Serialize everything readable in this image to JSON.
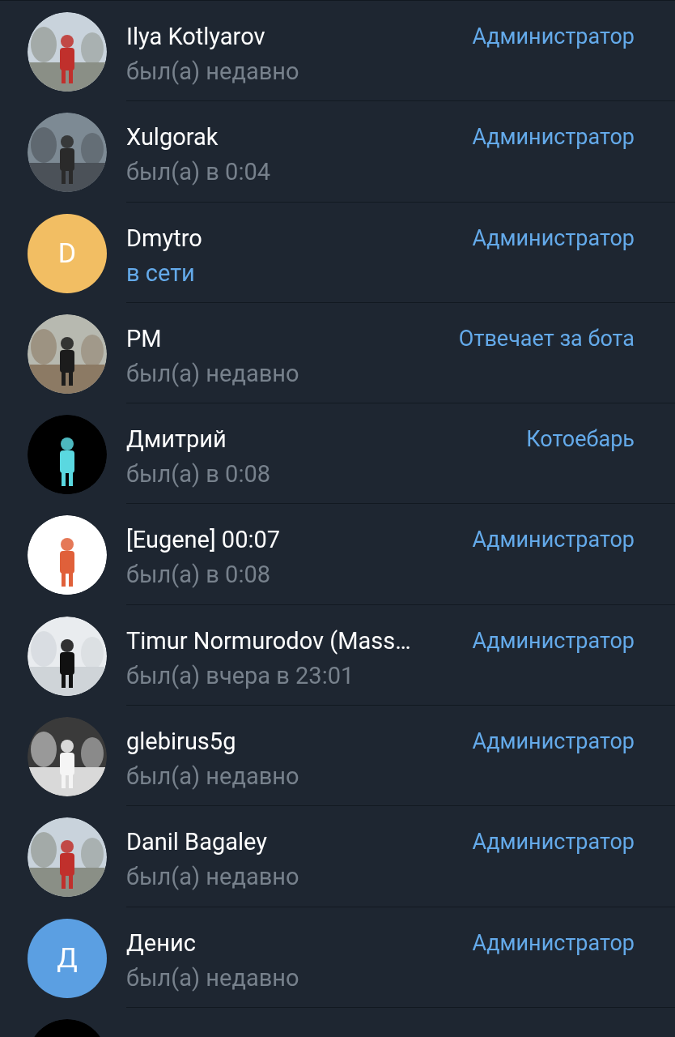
{
  "members": [
    {
      "avatar": {
        "kind": "picture"
      },
      "name": "Ilya Kotlyarov",
      "status": "был(а) недавно",
      "online": false,
      "role": "Администратор"
    },
    {
      "avatar": {
        "kind": "picture"
      },
      "name": "Xulgorak",
      "status": "был(а) в 0:04",
      "online": false,
      "role": "Администратор"
    },
    {
      "avatar": {
        "kind": "letter",
        "letter": "D",
        "color": "#f2be63"
      },
      "name": "Dmytro",
      "status": "в сети",
      "online": true,
      "role": "Администратор"
    },
    {
      "avatar": {
        "kind": "picture"
      },
      "name": "PM",
      "status": "был(а) недавно",
      "online": false,
      "role": "Отвечает за бота"
    },
    {
      "avatar": {
        "kind": "picture"
      },
      "name": "Дмитрий",
      "status": "был(а) в 0:08",
      "online": false,
      "role": "Котоебарь"
    },
    {
      "avatar": {
        "kind": "picture"
      },
      "name": "[Eugene] 00:07",
      "status": "был(а) в 0:08",
      "online": false,
      "role": "Администратор"
    },
    {
      "avatar": {
        "kind": "picture"
      },
      "name": "Timur Normurodov (Mass…",
      "status": "был(а) вчера в 23:01",
      "online": false,
      "role": "Администратор"
    },
    {
      "avatar": {
        "kind": "picture"
      },
      "name": "glebirus5g",
      "status": "был(а) недавно",
      "online": false,
      "role": "Администратор"
    },
    {
      "avatar": {
        "kind": "picture"
      },
      "name": "Danil Bagaley",
      "status": "был(а) недавно",
      "online": false,
      "role": "Администратор"
    },
    {
      "avatar": {
        "kind": "letter",
        "letter": "Д",
        "color": "#5b9fe2"
      },
      "name": "Денис",
      "status": "был(а) недавно",
      "online": false,
      "role": "Администратор"
    },
    {
      "avatar": {
        "kind": "picture"
      }
    }
  ]
}
